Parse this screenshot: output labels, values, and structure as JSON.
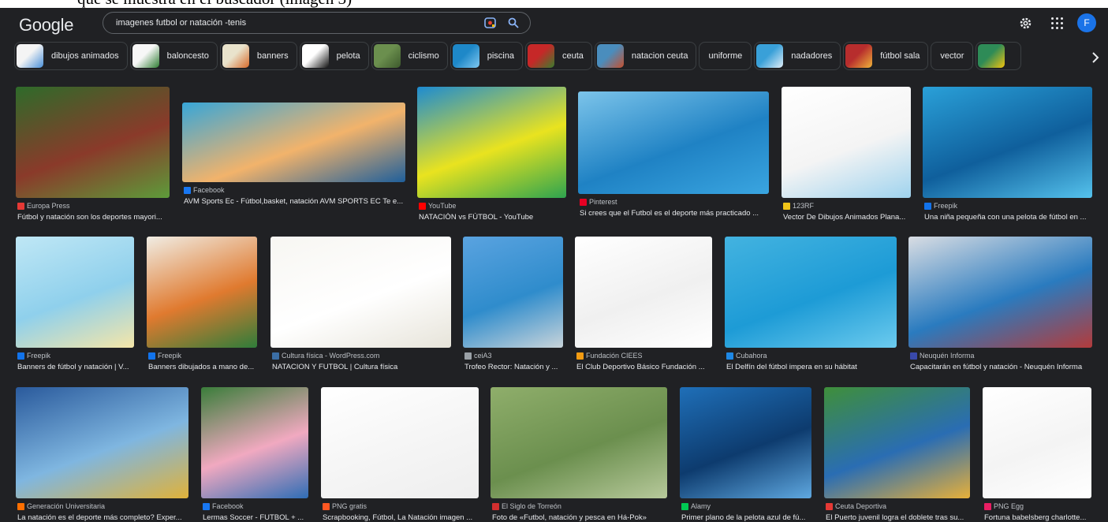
{
  "cropped_caption": "que se muestra en el buscador (imagen 3)",
  "header": {
    "logo": "Google",
    "query": "imagenes futbol or natación -tenis",
    "avatar_letter": "F"
  },
  "chips": [
    {
      "label": "dibujos animados",
      "colors": [
        "#f4f4f4",
        "#4a90d9"
      ]
    },
    {
      "label": "baloncesto",
      "colors": [
        "#f7f7f7",
        "#2e7d32"
      ]
    },
    {
      "label": "banners",
      "colors": [
        "#e9e3cc",
        "#d86a2a"
      ]
    },
    {
      "label": "pelota",
      "colors": [
        "#ffffff",
        "#111111"
      ]
    },
    {
      "label": "ciclismo",
      "colors": [
        "#6b8f4e",
        "#3d5a2c"
      ]
    },
    {
      "label": "piscina",
      "colors": [
        "#1e88c8",
        "#7fc8f0"
      ]
    },
    {
      "label": "ceuta",
      "colors": [
        "#c62828",
        "#3a7d2e"
      ]
    },
    {
      "label": "natacion ceuta",
      "colors": [
        "#4a8dbd",
        "#c5502f"
      ]
    },
    {
      "label": "uniforme",
      "colors": null
    },
    {
      "label": "nadadores",
      "colors": [
        "#39a0d8",
        "#e0eef8"
      ]
    },
    {
      "label": "fútbol sala",
      "colors": [
        "#b72d2d",
        "#f0b43a"
      ]
    },
    {
      "label": "vector",
      "colors": null
    },
    {
      "label": "",
      "colors": [
        "#2e8b57",
        "#f1c40f"
      ]
    }
  ],
  "results": [
    {
      "source": "Europa Press",
      "title": "Fútbol y natación son los deportes mayori...",
      "icon": "#e53935",
      "colors": [
        "#2e6b2a",
        "#8a3a2a",
        "#5d9b3a"
      ]
    },
    {
      "source": "Facebook",
      "title": "AVM Sports Ec - Fútbol,basket, natación AVM SPORTS EC Te e...",
      "icon": "#1877f2",
      "colors": [
        "#37a6d8",
        "#f2b36b",
        "#1f5f9b"
      ]
    },
    {
      "source": "YouTube",
      "title": "NATACIÓN vs FÚTBOL - YouTube",
      "icon": "#ff0000",
      "colors": [
        "#1d8bd1",
        "#e9e31f",
        "#2ea44f"
      ]
    },
    {
      "source": "Pinterest",
      "title": "Si crees que el Futbol es el deporte más practicado ...",
      "icon": "#e60023",
      "colors": [
        "#7cc4ea",
        "#1f82c4",
        "#3aa5e0"
      ]
    },
    {
      "source": "123RF",
      "title": "Vector De Dibujos Animados Plana...",
      "icon": "#f0c419",
      "colors": [
        "#ffffff",
        "#f4f4f4",
        "#9fd3ee"
      ]
    },
    {
      "source": "Freepik",
      "title": "Una niña pequeña con una pelota de fútbol en ...",
      "icon": "#1273eb",
      "colors": [
        "#2aa0d8",
        "#0f5f9c",
        "#55c2ec"
      ]
    },
    {
      "source": "Freepik",
      "title": "Banners de fútbol y natación | V...",
      "icon": "#1273eb",
      "colors": [
        "#bfe7f5",
        "#8fd0ec",
        "#f5e6a8"
      ]
    },
    {
      "source": "Freepik",
      "title": "Banners dibujados a mano de...",
      "icon": "#1273eb",
      "colors": [
        "#f0ede4",
        "#e07a2f",
        "#2f7d3a"
      ]
    },
    {
      "source": "Cultura física - WordPress.com",
      "title": "NATACION Y FUTBOL | Cultura física",
      "icon": "#3b6ea5",
      "colors": [
        "#f7f6f2",
        "#ffffff",
        "#e7e4da"
      ]
    },
    {
      "source": "ceiA3",
      "title": "Trofeo Rector: Natación y ...",
      "icon": "#9aa0a6",
      "colors": [
        "#5aa3e0",
        "#2f8ccc",
        "#c9d4da"
      ]
    },
    {
      "source": "Fundación CIEES",
      "title": "El Club Deportivo Básico Fundación ...",
      "icon": "#f39c12",
      "colors": [
        "#ffffff",
        "#f0f0f0",
        "#ffffff"
      ]
    },
    {
      "source": "Cubahora",
      "title": "El Delfín del fútbol impera en su hábitat",
      "icon": "#1e88e5",
      "colors": [
        "#43b3e0",
        "#1d9bd6",
        "#6ccbee"
      ]
    },
    {
      "source": "Neuquén Informa",
      "title": "Capacitarán en fútbol y natación - Neuquén Informa",
      "icon": "#3949ab",
      "colors": [
        "#d9dde3",
        "#2a7bbf",
        "#b33b3b"
      ]
    },
    {
      "source": "Generación Universitaria",
      "title": "La natación es el deporte más completo? Exper...",
      "icon": "#ff6f00",
      "colors": [
        "#2a5a9c",
        "#7fb6e0",
        "#e0b23a"
      ]
    },
    {
      "source": "Facebook",
      "title": "Lermas Soccer - FUTBOL + ...",
      "icon": "#1877f2",
      "colors": [
        "#3a7d3a",
        "#f1a9c0",
        "#2f6db5"
      ]
    },
    {
      "source": "PNG gratis",
      "title": "Scrapbooking, Fútbol, La Natación imagen ...",
      "icon": "#ff5722",
      "colors": [
        "#ffffff",
        "#f5f5f5",
        "#eeeeee"
      ]
    },
    {
      "source": "El Siglo de Torreón",
      "title": "Foto de «Futbol, natación y pesca en Há-Pok»",
      "icon": "#d32f2f",
      "colors": [
        "#8fae6b",
        "#6b8f4e",
        "#b7c99b"
      ]
    },
    {
      "source": "Alamy",
      "title": "Primer plano de la pelota azul de fú...",
      "icon": "#00c853",
      "colors": [
        "#1f6fb8",
        "#0d3b6e",
        "#5fa8e0"
      ]
    },
    {
      "source": "Ceuta Deportiva",
      "title": "El Puerto juvenil logra el doblete tras su...",
      "icon": "#e53935",
      "colors": [
        "#3f8f3a",
        "#2a6db3",
        "#e7b03a"
      ]
    },
    {
      "source": "PNG Egg",
      "title": "Fortuna babelsberg charlotte...",
      "icon": "#e91e63",
      "colors": [
        "#ffffff",
        "#f4f4f4",
        "#ffffff"
      ]
    }
  ]
}
